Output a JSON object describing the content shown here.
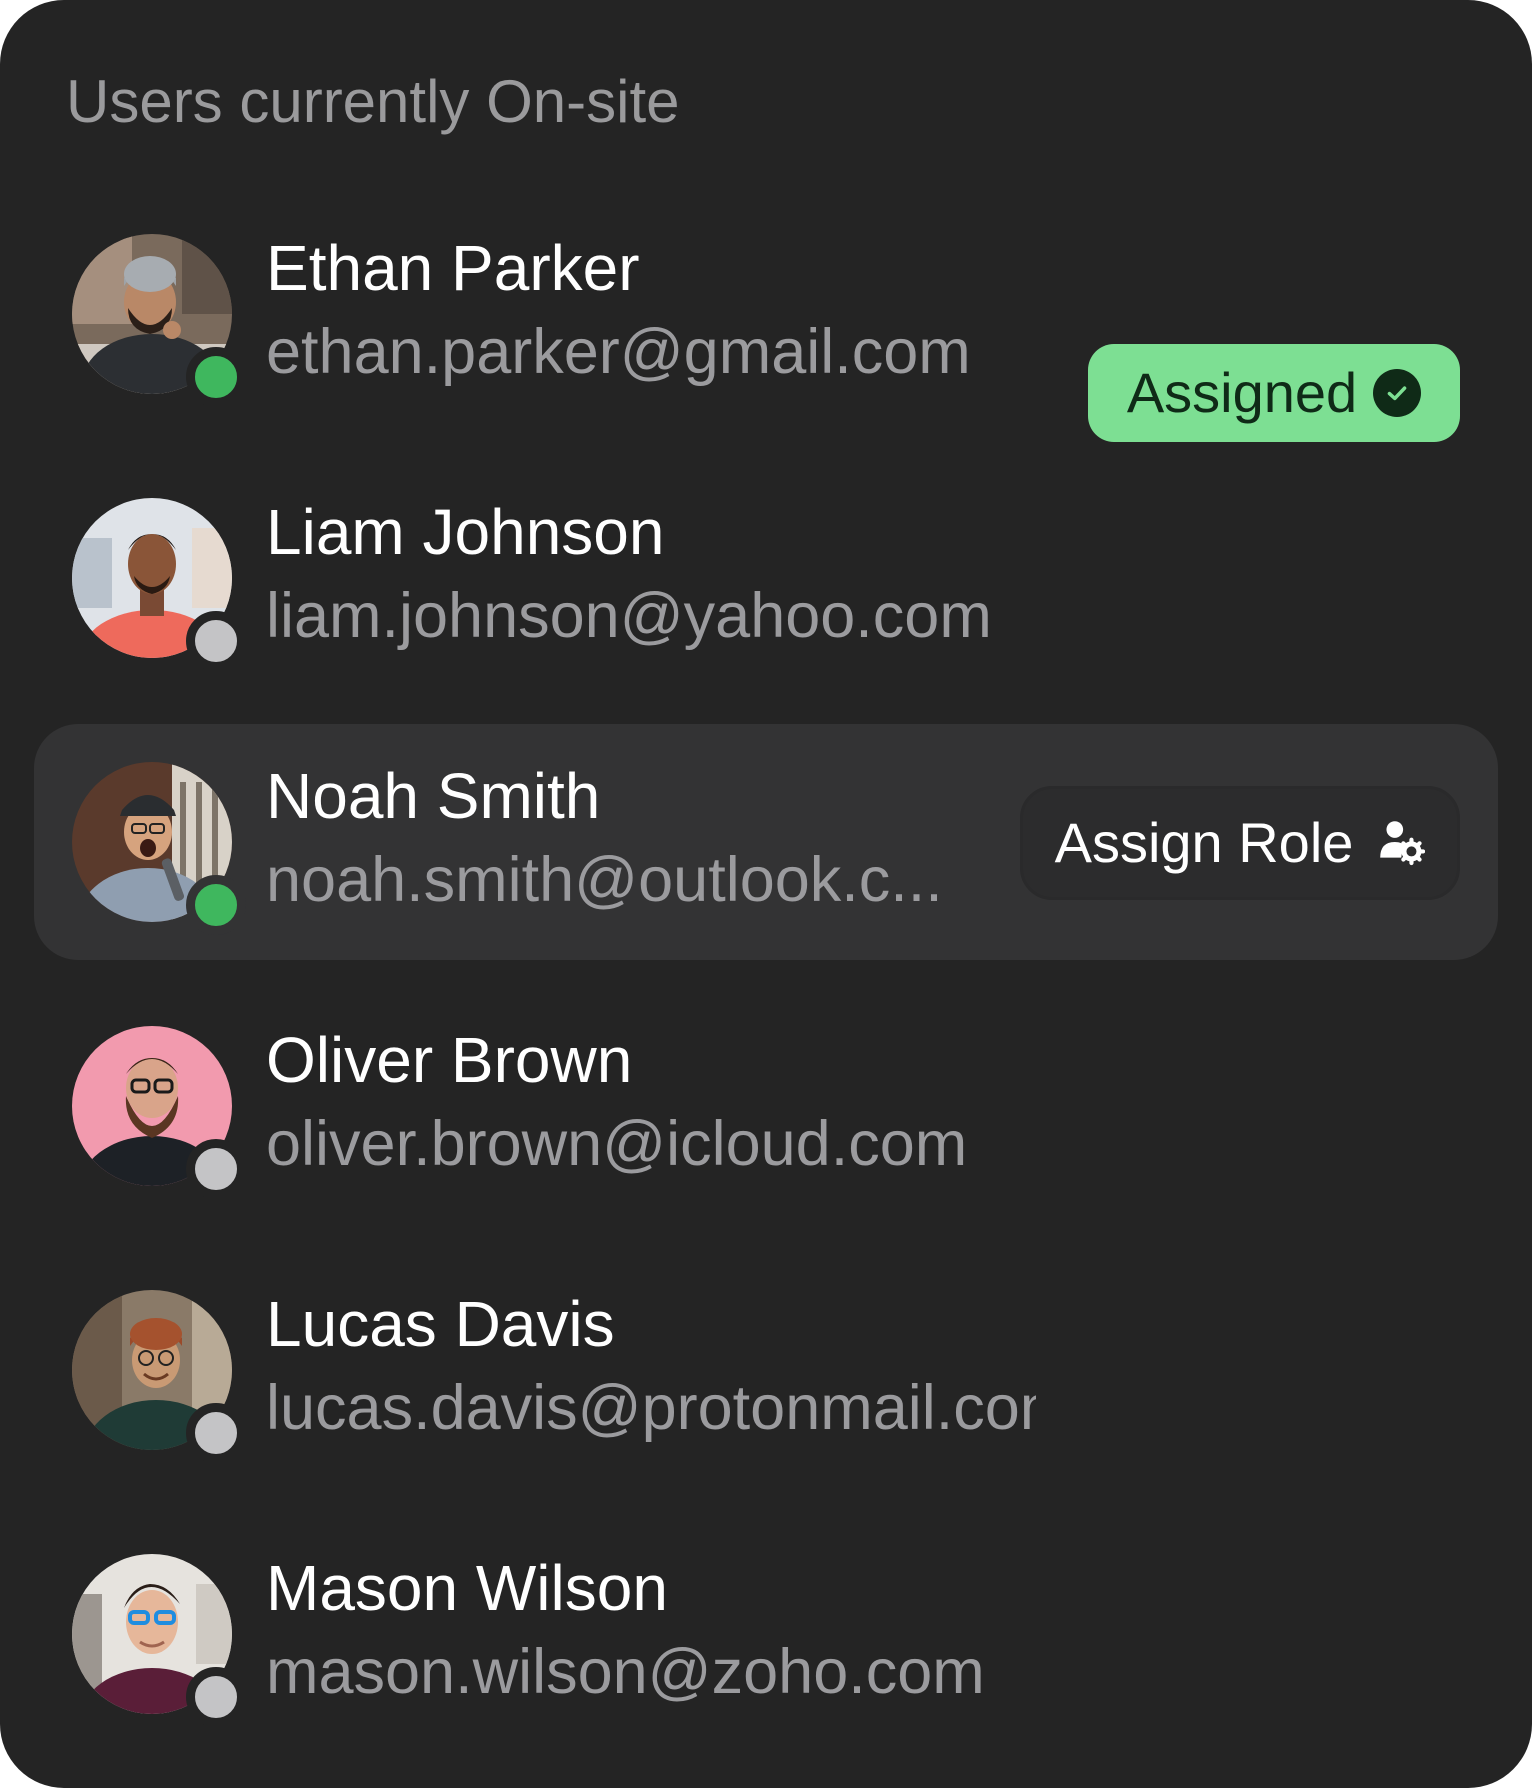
{
  "panel": {
    "title": "Users currently On-site"
  },
  "colors": {
    "panel_background": "#242424",
    "row_highlight": "#333334",
    "online": "#3fb75e",
    "offline": "#c4c4c6",
    "assigned_badge": "#7ddf93",
    "assigned_text": "#0f2a17"
  },
  "users": [
    {
      "name": "Ethan Parker",
      "email": "ethan.parker@gmail.com",
      "status": "online",
      "badge": {
        "label": "Assigned",
        "icon": "check-circle-icon"
      }
    },
    {
      "name": "Liam Johnson",
      "email": "liam.johnson@yahoo.com",
      "status": "offline"
    },
    {
      "name": "Noah Smith",
      "email": "noah.smith@outlook.c...",
      "status": "online",
      "highlighted": true,
      "action": {
        "label": "Assign Role",
        "icon": "user-gear-icon"
      }
    },
    {
      "name": "Oliver Brown",
      "email": "oliver.brown@icloud.com",
      "status": "offline"
    },
    {
      "name": "Lucas Davis",
      "email": "lucas.davis@protonmail.com",
      "status": "offline"
    },
    {
      "name": "Mason Wilson",
      "email": "mason.wilson@zoho.com",
      "status": "offline"
    }
  ]
}
